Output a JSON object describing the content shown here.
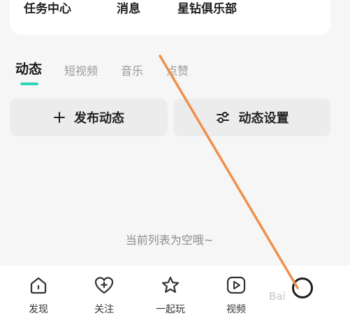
{
  "top_card": {
    "items": [
      "任务中心",
      "消息",
      "星钻俱乐部"
    ]
  },
  "tabs": [
    {
      "label": "动态",
      "active": true
    },
    {
      "label": "短视频",
      "active": false
    },
    {
      "label": "音乐",
      "active": false
    },
    {
      "label": "点赞",
      "active": false
    }
  ],
  "actions": {
    "publish_label": "发布动态",
    "settings_label": "动态设置"
  },
  "empty_state": "当前列表为空哦~",
  "bottom_nav": [
    {
      "label": "发现",
      "icon": "home-icon"
    },
    {
      "label": "关注",
      "icon": "heart-plus-icon"
    },
    {
      "label": "一起玩",
      "icon": "star-icon"
    },
    {
      "label": "视频",
      "icon": "play-icon"
    }
  ],
  "colors": {
    "accent": "#2fd6b5",
    "annotation_line": "#f0904a"
  }
}
